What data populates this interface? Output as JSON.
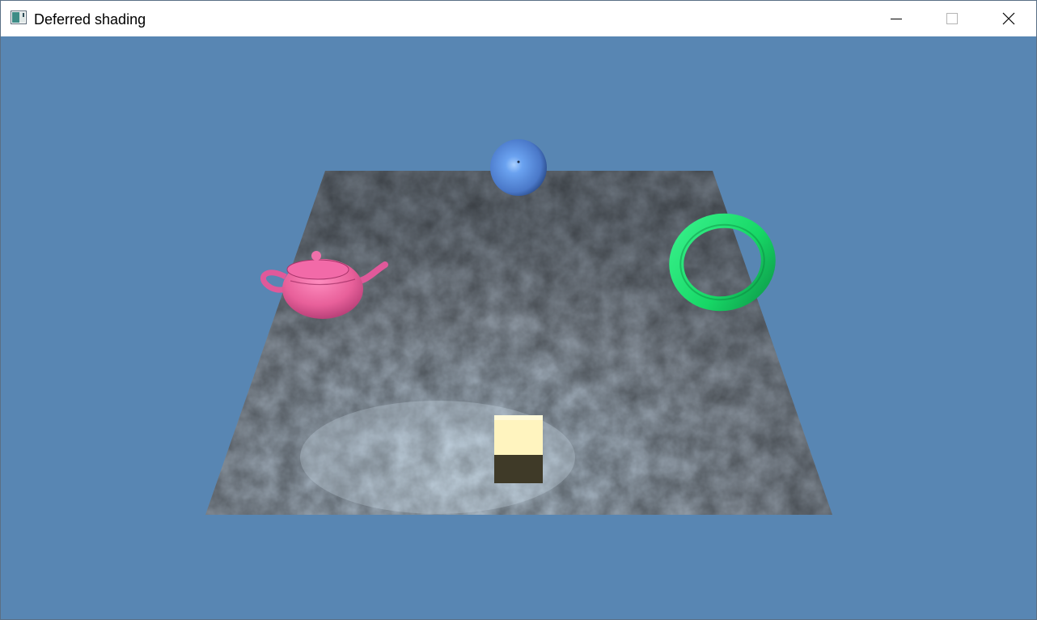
{
  "window": {
    "title": "Deferred shading",
    "app_icon": "application-window-icon",
    "controls": {
      "minimize_icon": "minimize-icon",
      "maximize_icon": "maximize-icon",
      "close_icon": "close-icon"
    }
  },
  "scene": {
    "background_color": "#5886b3",
    "objects": [
      {
        "name": "terrain-plane",
        "color": "#8b95a0"
      },
      {
        "name": "sphere",
        "color": "#5b8fe0"
      },
      {
        "name": "teapot",
        "color": "#e8609a"
      },
      {
        "name": "torus",
        "color": "#1ee06b"
      },
      {
        "name": "cube",
        "color": "#fff4bf"
      }
    ]
  }
}
